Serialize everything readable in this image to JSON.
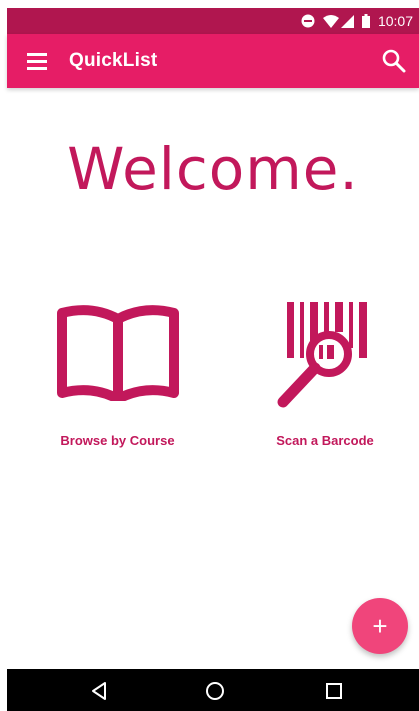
{
  "status_bar": {
    "time": "10:07",
    "icons": [
      "do-not-disturb-icon",
      "wifi-icon",
      "signal-icon",
      "battery-icon"
    ]
  },
  "app_bar": {
    "title": "QuickList",
    "menu_icon": "menu-icon",
    "search_icon": "search-icon"
  },
  "main": {
    "welcome": "Welcome.",
    "actions": [
      {
        "label": "Browse by Course",
        "icon": "open-book-icon"
      },
      {
        "label": "Scan a Barcode",
        "icon": "barcode-scan-icon"
      }
    ]
  },
  "fab": {
    "symbol": "+",
    "icon": "add-icon"
  },
  "nav_bar": {
    "icons": [
      "back-icon",
      "home-icon",
      "recents-icon"
    ]
  },
  "colors": {
    "status_bar": "#b0164f",
    "app_bar": "#e61d66",
    "accent": "#c2185b",
    "fab": "#f0457b"
  }
}
